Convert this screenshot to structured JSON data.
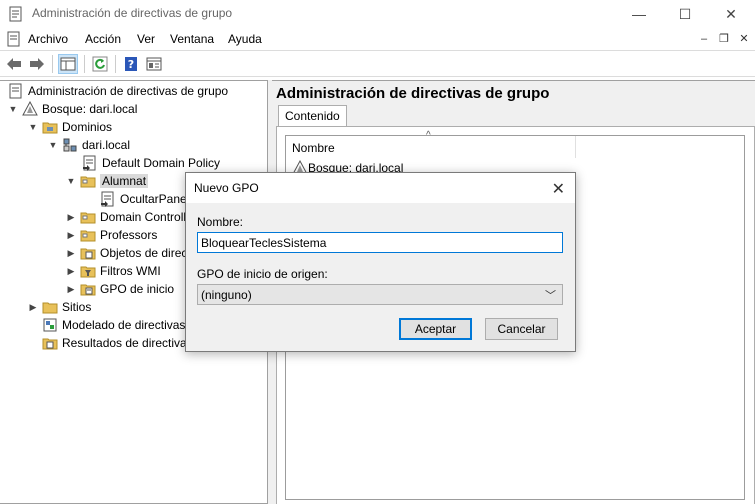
{
  "window": {
    "title": "Administración de directivas de grupo",
    "minimize": "—",
    "maximize": "☐",
    "close": "✕"
  },
  "menu": {
    "items": [
      "Archivo",
      "Acción",
      "Ver",
      "Ventana",
      "Ayuda"
    ],
    "mdi": {
      "minimize": "–",
      "restore": "❐",
      "close": "✕"
    }
  },
  "tree": {
    "root": "Administración de directivas de grupo",
    "forest": "Bosque: dari.local",
    "domains": "Dominios",
    "domain": "dari.local",
    "default_policy": "Default Domain Policy",
    "alumnat": "Alumnat",
    "ocultar": "OcultarPanel",
    "domain_controllers": "Domain Controllers",
    "professors": "Professors",
    "objetos": "Objetos de directiva de grupo",
    "filtros": "Filtros WMI",
    "gpo_inicio": "GPO de inicio",
    "sitios": "Sitios",
    "modelado": "Modelado de directivas de grupo",
    "resultados": "Resultados de directivas de grupo"
  },
  "right": {
    "title": "Administración de directivas de grupo",
    "tab": "Contenido",
    "column": "Nombre",
    "sort_indicator": "^",
    "row": "Bosque: dari.local"
  },
  "dialog": {
    "title": "Nuevo GPO",
    "close": "✕",
    "name_label": "Nombre:",
    "name_value": "BloquearTeclesSistema",
    "source_label": "GPO de inicio de origen:",
    "source_value": "(ninguno)",
    "ok": "Aceptar",
    "cancel": "Cancelar"
  },
  "colors": {
    "accent": "#0078d7",
    "folder": "#e8c15a",
    "selection": "#d9d9d9"
  }
}
